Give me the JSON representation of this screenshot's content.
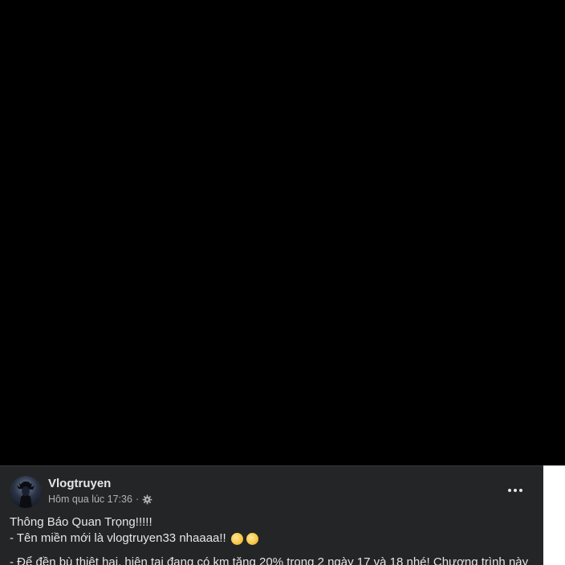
{
  "post": {
    "author": "Vlogtruyen",
    "timestamp": "Hôm qua lúc 17:36",
    "separator": "·",
    "audience_icon": "gear-icon",
    "menu_icon": "more-horizontal-icon",
    "lines": [
      "Thông Báo Quan Trọng!!!!!",
      "- Tên miền mới là vlogtruyen33 nhaaaa!!",
      "- Để đền bù thiệt hại, hiện tại đang có km tăng 20% trong 2 ngày 17 và 18 nhé! Chương trình này"
    ],
    "emojis": [
      "sun-emoji",
      "sun-emoji"
    ]
  },
  "colors": {
    "background": "#000000",
    "card": "#242526",
    "text_primary": "#e4e6eb",
    "text_secondary": "#b0b3b8"
  }
}
